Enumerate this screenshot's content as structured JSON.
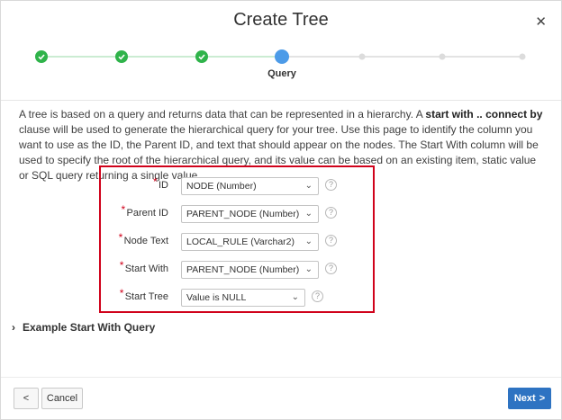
{
  "dialog": {
    "title": "Create Tree",
    "close_icon": "close-icon"
  },
  "wizard": {
    "current_label": "Query",
    "steps": [
      {
        "state": "done"
      },
      {
        "state": "done"
      },
      {
        "state": "done"
      },
      {
        "state": "current",
        "label": "Query"
      },
      {
        "state": "todo"
      },
      {
        "state": "todo"
      },
      {
        "state": "todo"
      }
    ],
    "colors": {
      "done": "#2fb34a",
      "current": "#4c9be8",
      "todo": "#dcdcdc"
    }
  },
  "description": {
    "part1": "A tree is based on a query and returns data that can be represented in a hierarchy. A ",
    "bold": "start with .. connect by",
    "part2": " clause will be used to generate the hierarchical query for your tree. Use this page to identify the column you want to use as the ID, the Parent ID, and text that should appear on the nodes. The Start With column will be used to specify the root of the hierarchical query, and its value can be based on an existing item, static value or SQL query returning a single value."
  },
  "form": {
    "required_mark": "*",
    "help_glyph": "?",
    "fields": [
      {
        "label": "ID",
        "value": "NODE (Number)"
      },
      {
        "label": "Parent ID",
        "value": "PARENT_NODE (Number)"
      },
      {
        "label": "Node Text",
        "value": "LOCAL_RULE (Varchar2)"
      },
      {
        "label": "Start With",
        "value": "PARENT_NODE (Number)"
      },
      {
        "label": "Start Tree",
        "value": "Value is NULL"
      }
    ]
  },
  "example": {
    "label": "Example Start With Query"
  },
  "footer": {
    "back_glyph": "<",
    "cancel_label": "Cancel",
    "next_label": "Next",
    "next_glyph": ">"
  }
}
